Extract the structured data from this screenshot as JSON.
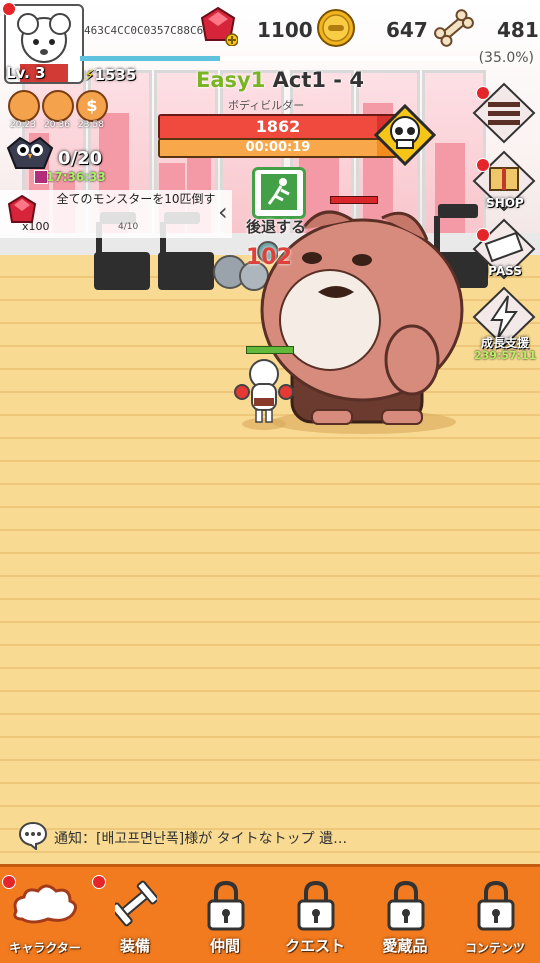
{
  "player": {
    "level": "Lv. 3",
    "user_id": "463C4CC0C0357C88C6",
    "power": "1535"
  },
  "resources": {
    "gems": "1100",
    "coins": "647",
    "bones": "481",
    "progress_pct": "(35.0%)",
    "progress_fraction": 0.35
  },
  "buffs": [
    {
      "icon": "cloud-buff-icon",
      "label": "20:23"
    },
    {
      "icon": "shoe-buff-icon",
      "label": "20:36"
    },
    {
      "icon": "dollar-buff-icon",
      "label": "23:58"
    }
  ],
  "owl": {
    "count": "0/20",
    "timer": "17:36:33"
  },
  "quest": {
    "text": "全てのモンスターを10匹倒す",
    "progress": "4/10",
    "reward": "x100"
  },
  "stage": {
    "difficulty": "Easy1",
    "act": "Act1 - 4",
    "enemy_name": "ボディビルダー",
    "boss_hp": "1862",
    "boss_hp_fraction": 0.92,
    "timer": "00:00:19",
    "timer_fraction": 0.92
  },
  "battle": {
    "retreat_label": "後退する",
    "damage": "102"
  },
  "side_menu": [
    {
      "id": "menu",
      "label": ""
    },
    {
      "id": "shop",
      "label": "SHOP"
    },
    {
      "id": "pass",
      "label": "PASS"
    },
    {
      "id": "boost",
      "label": "成長支援",
      "timer": "239:57:11"
    }
  ],
  "notice": {
    "prefix": "通知：",
    "text": "[배고프면난폭]様が タイトなトップ 遺…"
  },
  "bottom_nav": [
    {
      "id": "character",
      "label": "キャラクター",
      "locked": false
    },
    {
      "id": "equipment",
      "label": "装備",
      "locked": false
    },
    {
      "id": "companion",
      "label": "仲間",
      "locked": true
    },
    {
      "id": "quest",
      "label": "クエスト",
      "locked": true
    },
    {
      "id": "collection",
      "label": "愛蔵品",
      "locked": true
    },
    {
      "id": "content",
      "label": "コンテンツ",
      "locked": true
    }
  ],
  "colors": {
    "accent": "#f27b1f",
    "hp": "#d8332d",
    "timer": "#f28c1e",
    "floor": "#f8da92",
    "easy": "#7ab324"
  }
}
